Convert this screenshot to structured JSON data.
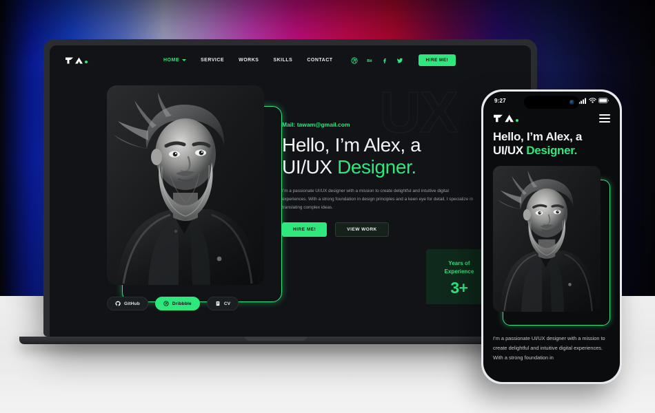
{
  "theme": {
    "accent_green": "#2EE87E",
    "screen_bg": "#111317",
    "laptop_body": "#2B2C30",
    "phone_frame": "#E8E9EC",
    "desk": "#EFEFEF"
  },
  "site": {
    "logo_text": "TA",
    "logo_dot": "accent-dot",
    "nav": {
      "links": [
        {
          "label": "HOME",
          "active": true,
          "has_dropdown": true
        },
        {
          "label": "SERVICE",
          "active": false,
          "has_dropdown": false
        },
        {
          "label": "WORKS",
          "active": false,
          "has_dropdown": false
        },
        {
          "label": "SKILLS",
          "active": false,
          "has_dropdown": false
        },
        {
          "label": "CONTACT",
          "active": false,
          "has_dropdown": false
        }
      ],
      "socials": [
        {
          "name": "dribbble-icon"
        },
        {
          "name": "behance-icon"
        },
        {
          "name": "facebook-icon"
        },
        {
          "name": "twitter-icon"
        }
      ],
      "cta_label": "HIRE ME!"
    },
    "hero": {
      "watermark": "UX",
      "mail_line": "Mail: tawam@gmail.com",
      "headline_line1": "Hello, I’m Alex, a",
      "headline_line2_plain": "UI/UX ",
      "headline_line2_accent": "Designer.",
      "paragraph": "I’m a passionate UI/UX designer with a mission to create delightful and intuitive digital experiences. With a strong foundation in design principles and a keen eye for detail, I specialize in translating complex ideas.",
      "primary_button": "HIRE ME!",
      "secondary_button": "VIEW WORK",
      "portrait_alt": "black-and-white portrait of bearded man in leather jacket"
    },
    "experience_card": {
      "label_line1": "Years of",
      "label_line2": "Experience",
      "value": "3+"
    },
    "social_pills": [
      {
        "label": "GitHub",
        "icon": "github-icon",
        "active": false
      },
      {
        "label": "Dribbble",
        "icon": "dribbble-icon",
        "active": true
      },
      {
        "label": "CV",
        "icon": "document-icon",
        "active": false
      }
    ]
  },
  "phone": {
    "status_bar": {
      "time": "9:27",
      "icons": [
        "cellular-signal-icon",
        "wifi-icon",
        "battery-icon"
      ]
    },
    "logo_text": "TA",
    "menu_icon": "hamburger-menu-icon",
    "headline_line1": "Hello, I’m Alex, a",
    "headline_line2_plain": "UI/UX ",
    "headline_line2_accent": "Designer.",
    "paragraph": "I’m a passionate UI/UX designer with a mission to create delightful and intuitive digital experiences. With a strong foundation in",
    "portrait_alt": "black-and-white portrait of bearded man in leather jacket"
  }
}
